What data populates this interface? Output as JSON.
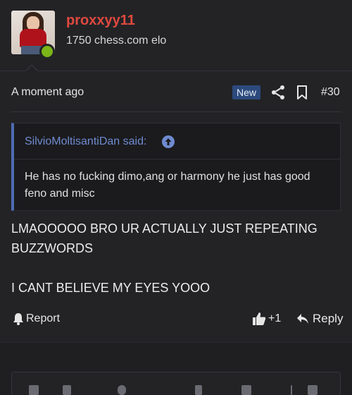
{
  "post": {
    "user": {
      "username": "proxxyy11",
      "title": "1750 chess.com elo",
      "online": true
    },
    "meta": {
      "timestamp": "A moment ago",
      "badge": "New",
      "post_number": "#30"
    },
    "quote": {
      "author": "SilvioMoltisantiDan said:",
      "text": "He has no fucking dimo,ang or harmony he just has good feno and misc"
    },
    "body": "LMAOOOOO BRO UR ACTUALLY JUST REPEATING BUZZWORDS\n\nI CANT BELIEVE MY EYES YOOO",
    "actions": {
      "report_label": "Report",
      "like_count": "+1",
      "reply_label": "Reply"
    }
  },
  "icons": {
    "share": "share-icon",
    "bookmark": "bookmark-icon",
    "quote_link": "arrow-up-circle-icon",
    "report": "bell-icon",
    "like": "thumbs-up-icon",
    "reply": "reply-arrow-icon"
  },
  "colors": {
    "background": "#1f1f22",
    "username": "#e0493f",
    "quote_border": "#4e6bb3",
    "quote_author": "#6f8bd0",
    "badge_bg": "#2c4a7d",
    "online": "#7cb519"
  }
}
